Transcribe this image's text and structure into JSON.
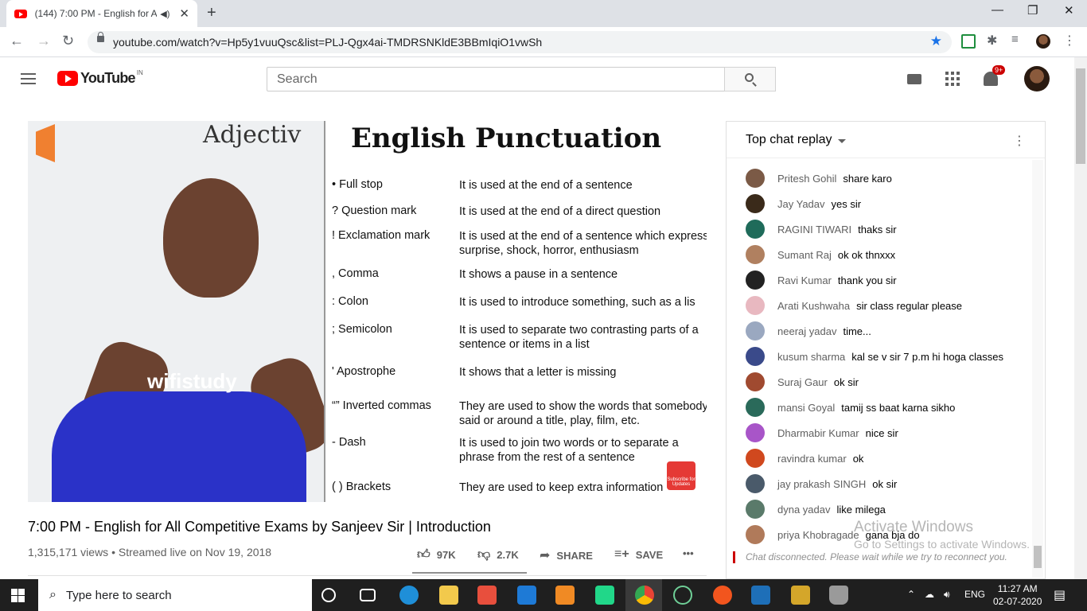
{
  "browser": {
    "tab_title": "(144) 7:00 PM - English for A",
    "url": "youtube.com/watch?v=Hp5y1vuuQsc&list=PLJ-Qgx4ai-TMDRSNKldE3BBmIqiO1vwSh"
  },
  "youtube": {
    "logo_text": "YouTube",
    "region": "IN",
    "search_placeholder": "Search",
    "notification_count": "9+"
  },
  "video": {
    "board_text": "Adjectiv",
    "slide_title": "English  Punctuation",
    "punctuation": [
      {
        "term": "• Full stop",
        "def": "It is used at the end of a sentence"
      },
      {
        "term": "? Question mark",
        "def": "It is used at the end of a direct question"
      },
      {
        "term": "! Exclamation mark",
        "def": "It is used at the end of a sentence which express surprise, shock, horror, enthusiasm"
      },
      {
        "term": ", Comma",
        "def": "It shows a pause in a sentence"
      },
      {
        "term": ": Colon",
        "def": "It is used to introduce something, such as a lis"
      },
      {
        "term": "; Semicolon",
        "def": "It is used to separate two contrasting parts of a sentence or items in a list"
      },
      {
        "term": "' Apostrophe",
        "def": "It shows that a letter is missing"
      },
      {
        "term": "“” Inverted commas",
        "def": "They are used to show the words that somebody said or around a title, play, film, etc."
      },
      {
        "term": "- Dash",
        "def": "It is used to join two words or to separate a phrase from the rest of a sentence"
      },
      {
        "term": "( ) Brackets",
        "def": "They are used to keep extra information"
      }
    ],
    "shirt_logo": "wifistudy",
    "subscribe_text": "Subscribe for Updates",
    "title": "7:00 PM - English for All Competitive Exams by Sanjeev Sir | Introduction",
    "meta": "1,315,171 views • Streamed live on Nov 19, 2018",
    "likes": "97K",
    "dislikes": "2.7K",
    "share_label": "SHARE",
    "save_label": "SAVE",
    "more_label": "•••"
  },
  "chat": {
    "title": "Top chat replay",
    "messages": [
      {
        "author": "Pritesh Gohil",
        "text": "share karo",
        "color": "#7b5a46"
      },
      {
        "author": "Jay Yadav",
        "text": "yes sir",
        "color": "#3a2a1a"
      },
      {
        "author": "RAGINI TIWARI",
        "text": "thaks sir",
        "color": "#1f6b5a"
      },
      {
        "author": "Sumant Raj",
        "text": "ok ok thnxxx",
        "color": "#b08060"
      },
      {
        "author": "Ravi Kumar",
        "text": "thank you sir",
        "color": "#222222"
      },
      {
        "author": "Arati Kushwaha",
        "text": "sir class regular please",
        "color": "#e8b8c0"
      },
      {
        "author": "neeraj yadav",
        "text": "time...",
        "color": "#9aa8c0"
      },
      {
        "author": "kusum sharma",
        "text": "kal se v sir 7 p.m hi hoga classes",
        "color": "#3a4a8a"
      },
      {
        "author": "Suraj Gaur",
        "text": "ok sir",
        "color": "#a04a30"
      },
      {
        "author": "mansi Goyal",
        "text": "tamij ss baat karna sikho",
        "color": "#2a6a5a"
      },
      {
        "author": "Dharmabir Kumar",
        "text": "nice sir",
        "color": "#a855c8"
      },
      {
        "author": "ravindra kumar",
        "text": "ok",
        "color": "#d0481e"
      },
      {
        "author": "jay prakash SINGH",
        "text": "ok sir",
        "color": "#4a5a6a"
      },
      {
        "author": "dyna yadav",
        "text": "like milega",
        "color": "#5a7a6a"
      },
      {
        "author": "priya Khobragade",
        "text": "gana bja do",
        "color": "#b07a5a"
      }
    ],
    "disconnected_note": "Chat disconnected. Please wait while we try to reconnect you."
  },
  "watermark": {
    "line1": "Activate Windows",
    "line2": "Go to Settings to activate Windows."
  },
  "taskbar": {
    "search_text": "Type here to search",
    "language": "ENG",
    "time": "11:27 AM",
    "date": "02-07-2020"
  }
}
